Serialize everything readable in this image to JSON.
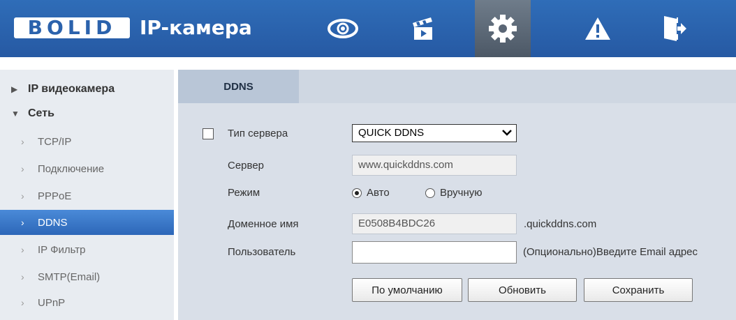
{
  "header": {
    "logo_text": "BOLID",
    "title": "IP-камера",
    "nav": [
      {
        "name": "live-view-eye-icon"
      },
      {
        "name": "playback-clapper-icon"
      },
      {
        "name": "settings-gear-icon",
        "active": true
      },
      {
        "name": "alarm-warning-icon"
      },
      {
        "name": "logout-door-icon"
      }
    ],
    "colors": {
      "header_bg": "#2b62ac",
      "active_bg": "#5a6675"
    }
  },
  "sidebar": {
    "items": [
      {
        "label": "IP видеокамера",
        "type": "group",
        "expanded": false
      },
      {
        "label": "Сеть",
        "type": "group",
        "expanded": true
      },
      {
        "label": "TCP/IP",
        "type": "sub"
      },
      {
        "label": "Подключение",
        "type": "sub"
      },
      {
        "label": "PPPoE",
        "type": "sub"
      },
      {
        "label": "DDNS",
        "type": "sub",
        "active": true
      },
      {
        "label": "IP Фильтр",
        "type": "sub"
      },
      {
        "label": "SMTP(Email)",
        "type": "sub"
      },
      {
        "label": "UPnP",
        "type": "sub"
      }
    ]
  },
  "content": {
    "tab": "DDNS",
    "form": {
      "server_type_label": "Тип сервера",
      "server_type_checked": false,
      "server_type_value": "QUICK DDNS",
      "server_label": "Сервер",
      "server_value": "www.quickddns.com",
      "mode_label": "Режим",
      "mode_auto": "Авто",
      "mode_manual": "Вручную",
      "mode_selected": "Авто",
      "domain_label": "Доменное имя",
      "domain_value": "E0508B4BDC26",
      "domain_suffix": ".quickddns.com",
      "user_label": "Пользователь",
      "user_value": "",
      "user_hint": "(Опционально)Введите Email адрес"
    },
    "buttons": {
      "default": "По умолчанию",
      "refresh": "Обновить",
      "save": "Сохранить"
    }
  }
}
